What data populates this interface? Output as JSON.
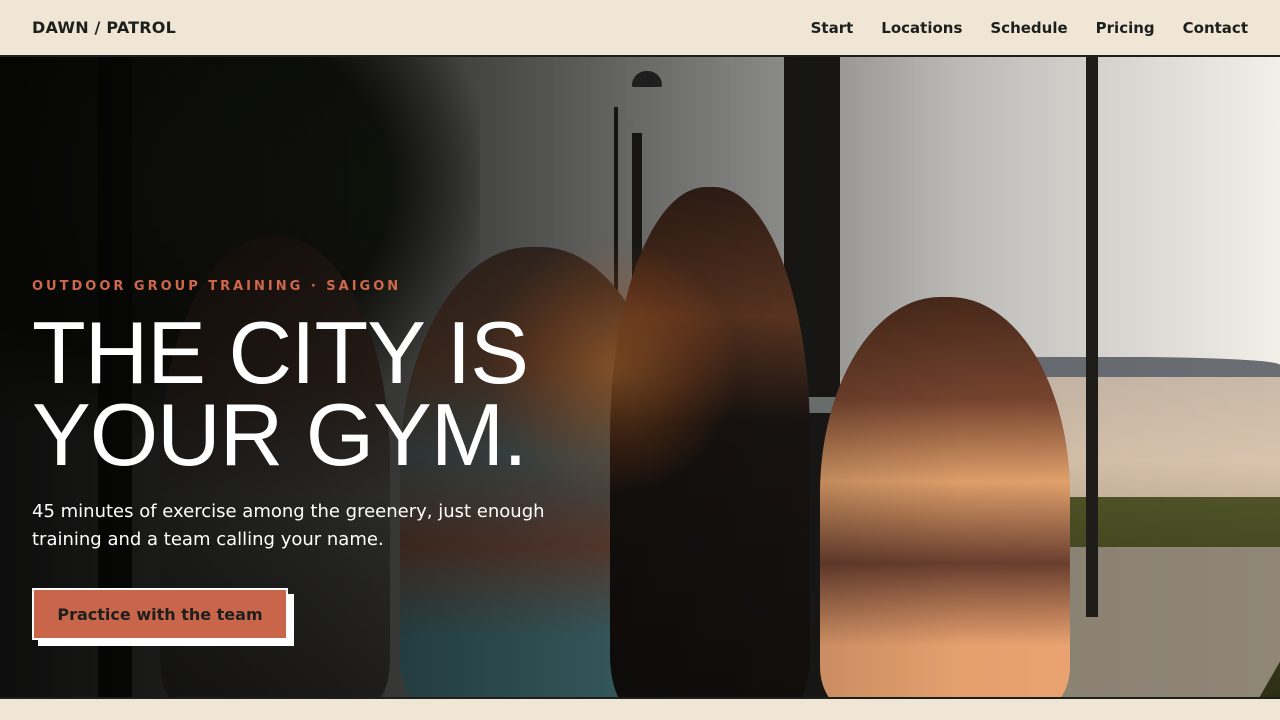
{
  "header": {
    "brand": "DAWN / PATROL",
    "nav": [
      "Start",
      "Locations",
      "Schedule",
      "Pricing",
      "Contact"
    ]
  },
  "hero": {
    "eyebrow": "OUTDOOR GROUP TRAINING · SAIGON",
    "headline_line1": "THE CITY IS",
    "headline_line2": "YOUR GYM.",
    "subtext": "45 minutes of exercise among the greenery, just enough training and a team calling your name.",
    "cta_label": "Practice with the team"
  },
  "colors": {
    "background": "#efe6d6",
    "accent": "#c9654a",
    "text_dark": "#1d1f1c",
    "text_light": "#ffffff"
  }
}
